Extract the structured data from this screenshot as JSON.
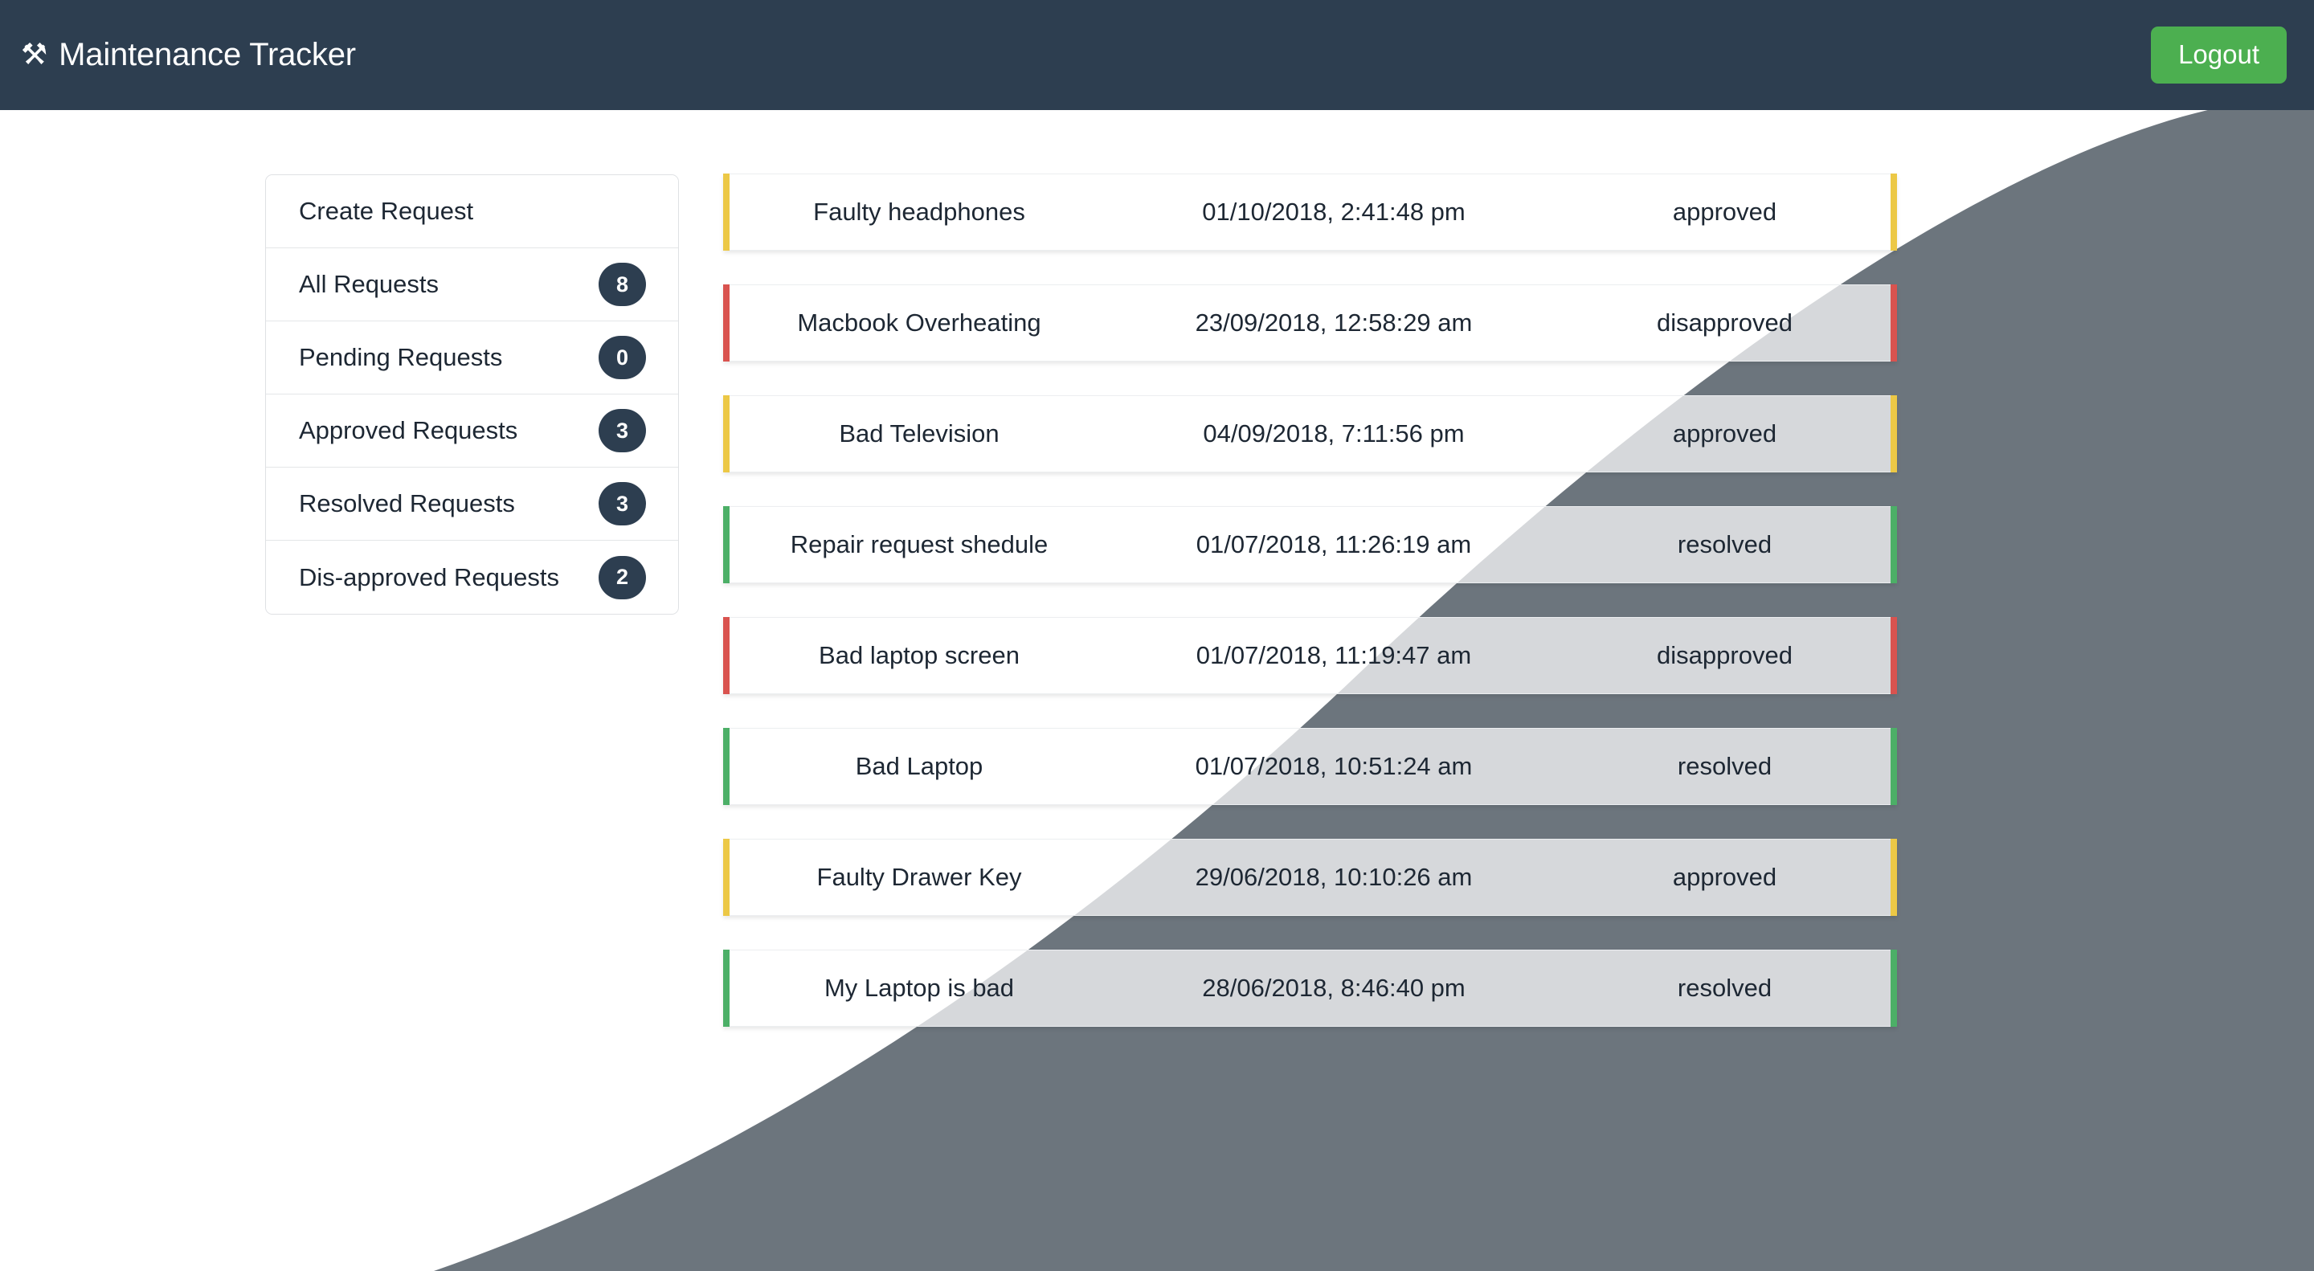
{
  "header": {
    "brand_icon": "hammer-and-wrench-icon",
    "brand_glyph": "⚒",
    "title": "Maintenance Tracker",
    "logout_label": "Logout",
    "background_color": "#2d3e50",
    "logout_color": "#4caf50"
  },
  "theme": {
    "page_background": "#ffffff",
    "curve_color": "#6c757d",
    "badge_color": "#2d3e50",
    "accent_approved": "#ecc846",
    "accent_disapproved": "#d9534f",
    "accent_resolved": "#4caf67",
    "text_color": "#1d2733"
  },
  "sidebar": {
    "items": [
      {
        "label": "Create Request",
        "count": null,
        "has_badge": false
      },
      {
        "label": "All Requests",
        "count": "8",
        "has_badge": true
      },
      {
        "label": "Pending Requests",
        "count": "0",
        "has_badge": true
      },
      {
        "label": "Approved Requests",
        "count": "3",
        "has_badge": true
      },
      {
        "label": "Resolved Requests",
        "count": "3",
        "has_badge": true
      },
      {
        "label": "Dis-approved Requests",
        "count": "2",
        "has_badge": true
      }
    ]
  },
  "requests": {
    "rows": [
      {
        "title": "Faulty headphones",
        "date": "01/10/2018, 2:41:48 pm",
        "status": "approved",
        "accent": "#ecc846"
      },
      {
        "title": "Macbook Overheating",
        "date": "23/09/2018, 12:58:29 am",
        "status": "disapproved",
        "accent": "#d9534f"
      },
      {
        "title": "Bad Television",
        "date": "04/09/2018, 7:11:56 pm",
        "status": "approved",
        "accent": "#ecc846"
      },
      {
        "title": "Repair request shedule",
        "date": "01/07/2018, 11:26:19 am",
        "status": "resolved",
        "accent": "#4caf67"
      },
      {
        "title": "Bad laptop screen",
        "date": "01/07/2018, 11:19:47 am",
        "status": "disapproved",
        "accent": "#d9534f"
      },
      {
        "title": "Bad Laptop",
        "date": "01/07/2018, 10:51:24 am",
        "status": "resolved",
        "accent": "#4caf67"
      },
      {
        "title": "Faulty Drawer Key",
        "date": "29/06/2018, 10:10:26 am",
        "status": "approved",
        "accent": "#ecc846"
      },
      {
        "title": "My Laptop is bad",
        "date": "28/06/2018, 8:46:40 pm",
        "status": "resolved",
        "accent": "#4caf67"
      }
    ]
  }
}
